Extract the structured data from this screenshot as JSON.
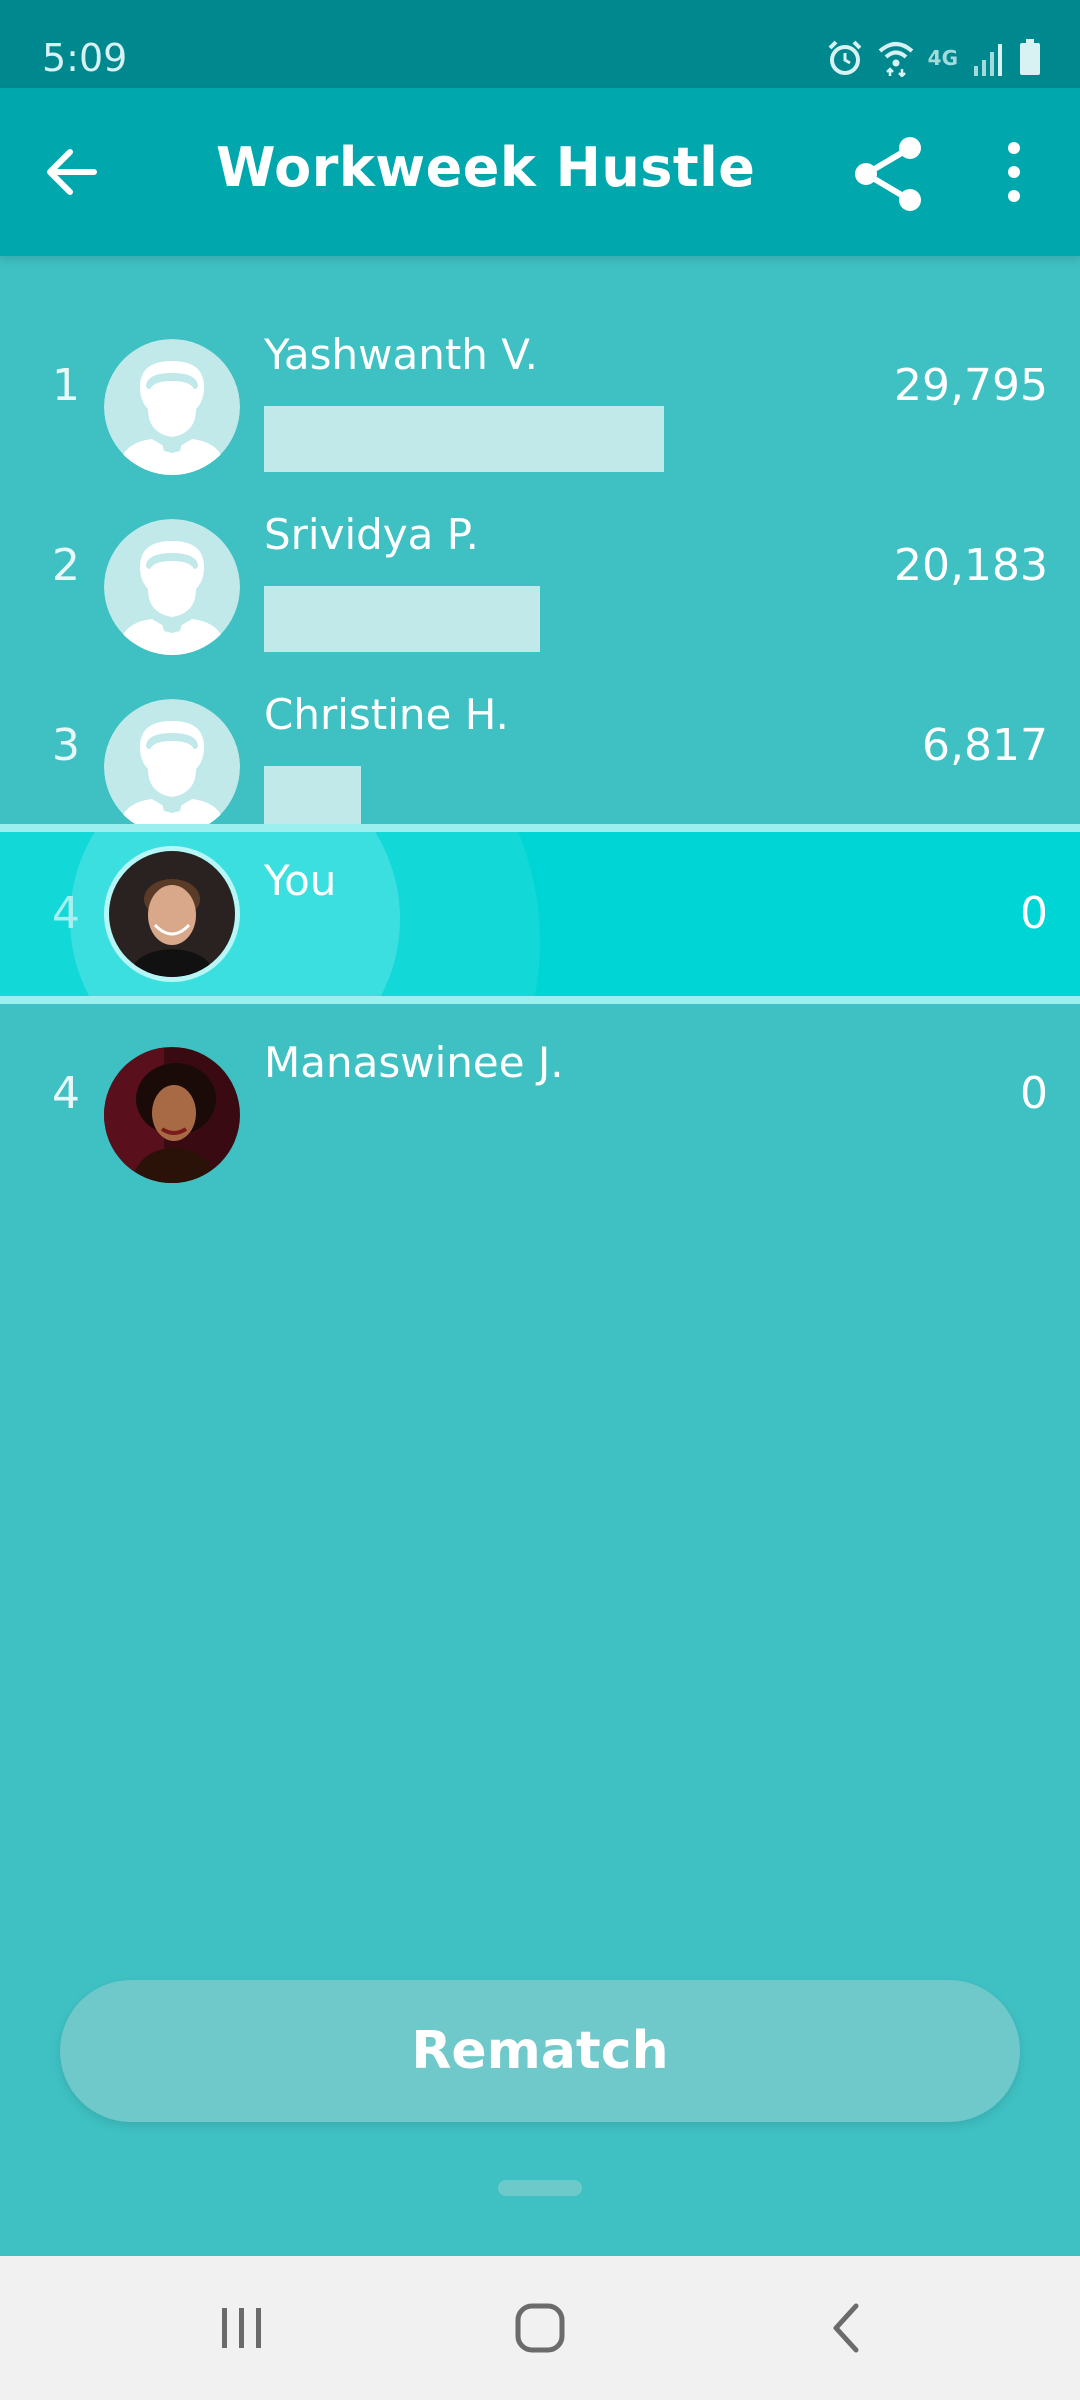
{
  "status_bar": {
    "time": "5:09",
    "network_label": "4G",
    "icons": [
      "alarm-icon",
      "wifi-icon",
      "signal-icon",
      "battery-icon"
    ]
  },
  "app_bar": {
    "title": "Workweek Hustle",
    "icons": [
      "back-arrow-icon",
      "share-icon",
      "more-vert-icon"
    ]
  },
  "leaderboard": [
    {
      "rank": "1",
      "name": "Yashwanth V.",
      "score": "29,795",
      "progress": 0.4
    },
    {
      "rank": "2",
      "name": "Srividya P.",
      "score": "20,183",
      "progress": 0.276
    },
    {
      "rank": "3",
      "name": "Christine H.",
      "score": "6,817",
      "progress": 0.097
    },
    {
      "rank": "4",
      "name": "You",
      "score": "0",
      "progress": 0
    },
    {
      "rank": "4",
      "name": "Manaswinee J.",
      "score": "0",
      "progress": 0
    }
  ],
  "rematch_label": "Rematch",
  "colors": {
    "status_bar": "#00888f",
    "app_bar": "#00a8ae",
    "background": "#3fc1c3",
    "highlight_row": "#00d5d6",
    "progress_bar": "#c1e9ea",
    "button": "#6fc8c9"
  },
  "system_nav": [
    "recents-icon",
    "home-icon",
    "back-icon"
  ]
}
